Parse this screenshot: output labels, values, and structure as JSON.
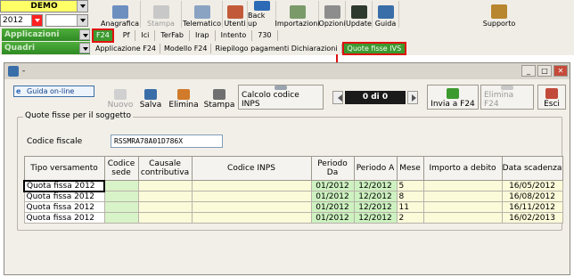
{
  "app": {
    "demo_label": "DEMO",
    "year_value": "2012",
    "applicazioni_label": "Applicazioni",
    "quadri_label": "Quadri",
    "toolbar": [
      {
        "label": "Anagrafica",
        "icon": "anagrafica-icon",
        "enabled": true
      },
      {
        "label": "Stampa",
        "icon": "print-icon",
        "enabled": false
      },
      {
        "label": "Telematico",
        "icon": "telematico-icon",
        "enabled": true
      },
      {
        "label": "Utenti",
        "icon": "users-icon",
        "enabled": true
      },
      {
        "label": "Back up",
        "icon": "backup-icon",
        "enabled": true
      },
      {
        "label": "Importazioni",
        "icon": "import-icon",
        "enabled": true
      },
      {
        "label": "Opzioni",
        "icon": "options-icon",
        "enabled": true
      },
      {
        "label": "Update",
        "icon": "update-icon",
        "enabled": true
      },
      {
        "label": "Guida",
        "icon": "help-book-icon",
        "enabled": true
      }
    ],
    "supporto_label": "Supporto",
    "tabs_row1": [
      "F24",
      "Pf",
      "Ici",
      "TerFab",
      "Irap",
      "Intento",
      "730"
    ],
    "tabs_row2": [
      "Applicazione F24",
      "Modello F24",
      "Riepilogo pagamenti Dichiarazioni",
      "Quote fisse IVS"
    ]
  },
  "window": {
    "title": "-",
    "guida_label": "Guida on-line",
    "buttons": {
      "nuovo": "Nuovo",
      "salva": "Salva",
      "elimina": "Elimina",
      "stampa": "Stampa",
      "calcolo": "Calcolo codice INPS",
      "invia": "Invia a F24",
      "elimina_f24": "Elimina F24",
      "esci": "Esci"
    },
    "counter": "0 di 0",
    "group_label": "Quote fisse per il soggetto",
    "codice_fiscale_label": "Codice fiscale",
    "codice_fiscale_value": "RSSMRA78A01D786X",
    "columns": [
      "Tipo versamento",
      "Codice sede",
      "Causale contributiva",
      "Codice INPS",
      "Periodo Da",
      "Periodo A",
      "Mese",
      "Importo a debito",
      "Data scadenza"
    ],
    "rows": [
      {
        "tipo": "Quota fissa 2012",
        "sede": "",
        "causale": "",
        "inps": "",
        "da": "01/2012",
        "a": "12/2012",
        "mese": "5",
        "importo": "",
        "scadenza": "16/05/2012"
      },
      {
        "tipo": "Quota fissa 2012",
        "sede": "",
        "causale": "",
        "inps": "",
        "da": "01/2012",
        "a": "12/2012",
        "mese": "8",
        "importo": "",
        "scadenza": "16/08/2012"
      },
      {
        "tipo": "Quota fissa 2012",
        "sede": "",
        "causale": "",
        "inps": "",
        "da": "01/2012",
        "a": "12/2012",
        "mese": "11",
        "importo": "",
        "scadenza": "16/11/2012"
      },
      {
        "tipo": "Quota fissa 2012",
        "sede": "",
        "causale": "",
        "inps": "",
        "da": "01/2012",
        "a": "12/2012",
        "mese": "2",
        "importo": "",
        "scadenza": "16/02/2013"
      }
    ]
  },
  "colors": {
    "green_accent": "#3c9a2f",
    "highlight_red": "#e01010",
    "demo_yellow": "#ffff66"
  }
}
